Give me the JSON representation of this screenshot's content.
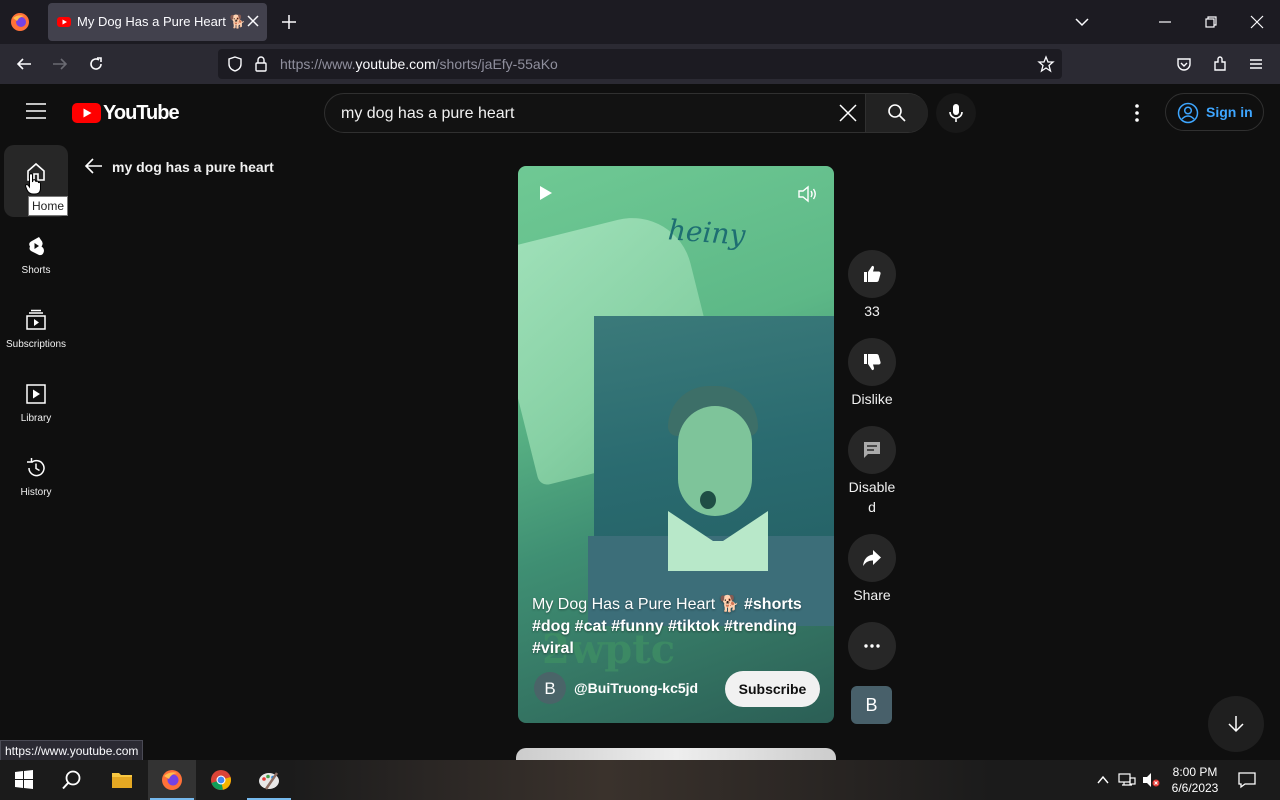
{
  "browser": {
    "tab_title": "My Dog Has a Pure Heart 🐕 #shorts",
    "url_prefix": "https://www.",
    "url_domain": "youtube.com",
    "url_path": "/shorts/jaEfy-55aKo",
    "status_url": "https://www.youtube.com"
  },
  "header": {
    "logo_text": "YouTube",
    "search_query": "my dog has a pure heart",
    "signin_label": "Sign in"
  },
  "guide": {
    "items": [
      {
        "label": "Home",
        "icon": "home-icon"
      },
      {
        "label": "Shorts",
        "icon": "shorts-icon"
      },
      {
        "label": "Subscriptions",
        "icon": "subscriptions-icon"
      },
      {
        "label": "Library",
        "icon": "library-icon"
      },
      {
        "label": "History",
        "icon": "history-icon"
      }
    ],
    "tooltip": "Home"
  },
  "back_label": "my dog has a pure heart",
  "short": {
    "caption_title": "My Dog Has a Pure Heart 🐕 ",
    "caption_tags": "#shorts #dog #cat #funny #tiktok #trending #viral",
    "overlay_text": "heiny",
    "watermark": "2wptc",
    "channel_initial": "B",
    "channel_handle": "@BuiTruong-kc5jd",
    "subscribe_label": "Subscribe"
  },
  "actions": {
    "like_count": "33",
    "dislike_label": "Dislike",
    "comments_label_1": "Disable",
    "comments_label_2": "d",
    "share_label": "Share",
    "channel_tile": "B"
  },
  "taskbar": {
    "time": "8:00 PM",
    "date": "6/6/2023"
  },
  "colors": {
    "youtube_red": "#ff0000",
    "link_blue": "#3ea6ff",
    "video_tint": "#5db887"
  }
}
